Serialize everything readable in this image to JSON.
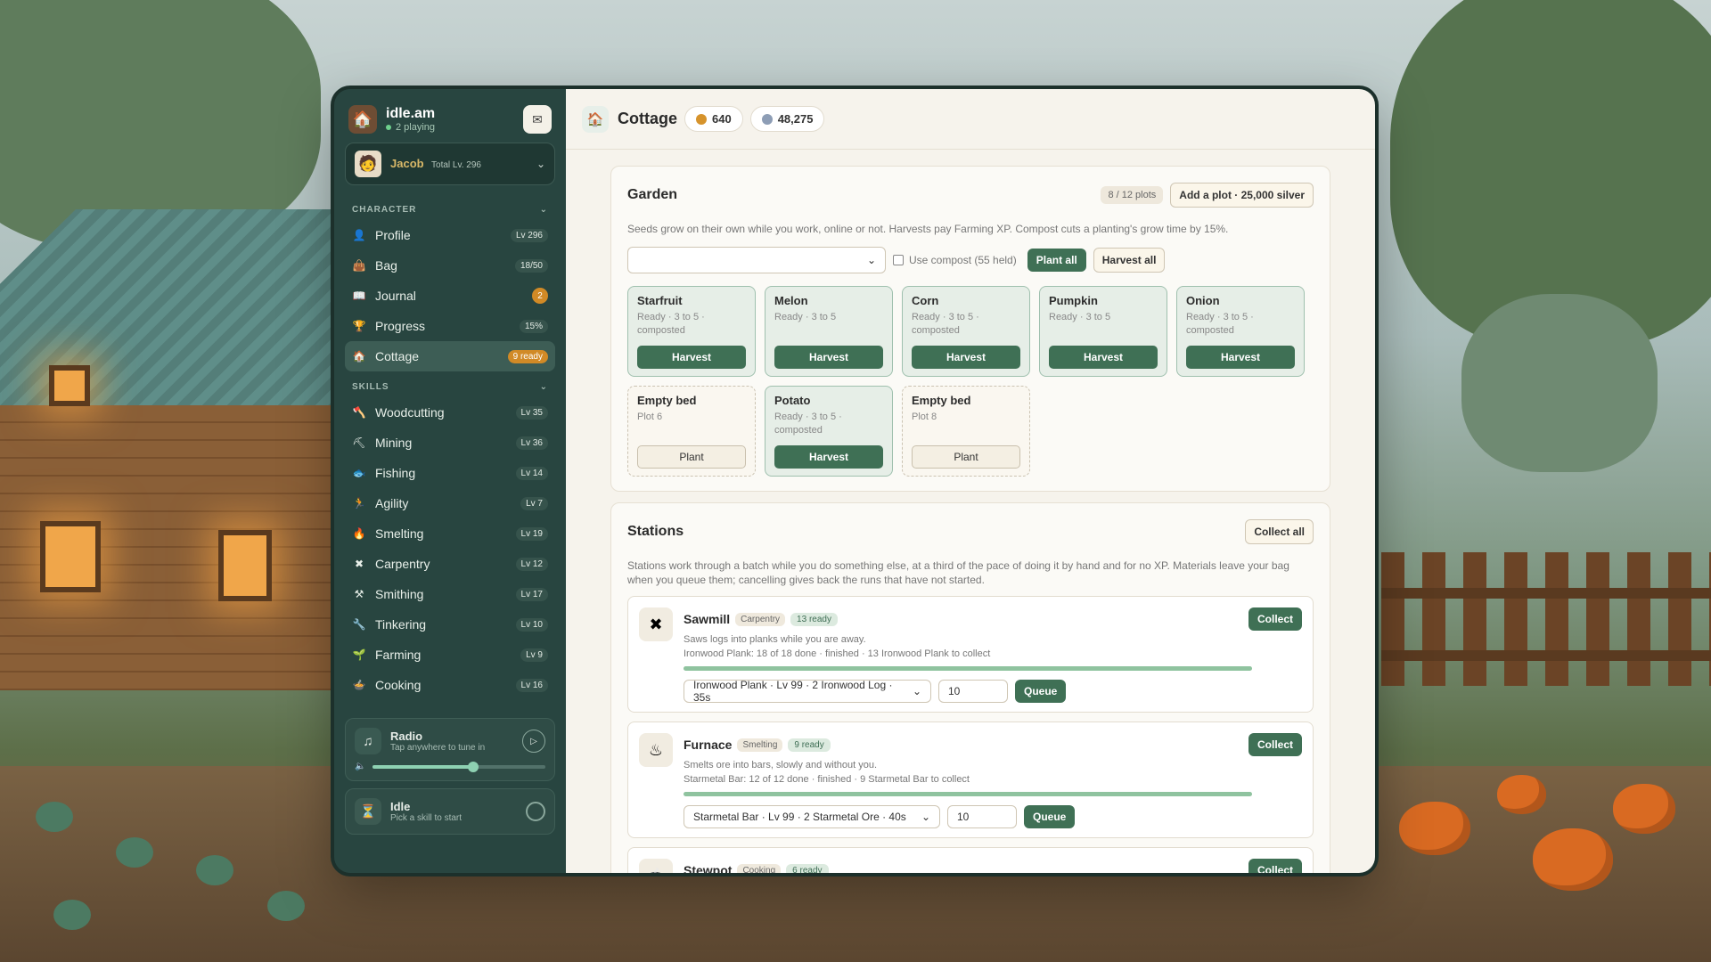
{
  "app": {
    "name": "idle.am",
    "playing": "2 playing",
    "mail_icon": "mail-icon"
  },
  "character": {
    "name": "Jacob",
    "total_level": "Total Lv. 296"
  },
  "sections": {
    "character": "CHARACTER",
    "skills": "SKILLS"
  },
  "character_nav": [
    {
      "label": "Profile",
      "badge": "Lv 296",
      "icon": "profile-icon"
    },
    {
      "label": "Bag",
      "badge": "18/50",
      "icon": "bag-icon"
    },
    {
      "label": "Journal",
      "badge": "2",
      "icon": "journal-icon"
    },
    {
      "label": "Progress",
      "badge": "15%",
      "icon": "trophy-icon"
    },
    {
      "label": "Cottage",
      "badge": "9 ready",
      "icon": "cottage-icon"
    }
  ],
  "skills_nav": [
    {
      "label": "Woodcutting",
      "badge": "Lv 35"
    },
    {
      "label": "Mining",
      "badge": "Lv 36"
    },
    {
      "label": "Fishing",
      "badge": "Lv 14"
    },
    {
      "label": "Agility",
      "badge": "Lv 7"
    },
    {
      "label": "Smelting",
      "badge": "Lv 19"
    },
    {
      "label": "Carpentry",
      "badge": "Lv 12"
    },
    {
      "label": "Smithing",
      "badge": "Lv 17"
    },
    {
      "label": "Tinkering",
      "badge": "Lv 10"
    },
    {
      "label": "Farming",
      "badge": "Lv 9"
    },
    {
      "label": "Cooking",
      "badge": "Lv 16"
    }
  ],
  "radio": {
    "title": "Radio",
    "subtitle": "Tap anywhere to tune in",
    "volume": 0.58
  },
  "idle": {
    "title": "Idle",
    "subtitle": "Pick a skill to start"
  },
  "topbar": {
    "title": "Cottage",
    "gold": "640",
    "silver": "48,275",
    "gold_color": "#d6932c",
    "silver_color": "#8d9db5"
  },
  "garden": {
    "title": "Garden",
    "plots": "8 / 12 plots",
    "add_plot": "Add a plot · 25,000 silver",
    "description": "Seeds grow on their own while you work, online or not. Harvests pay Farming XP. Compost cuts a planting's grow time by 15%.",
    "seed_select": "",
    "compost_label": "Use compost (55 held)",
    "plant_all": "Plant all",
    "harvest_all": "Harvest all",
    "beds": [
      {
        "name": "Starfruit",
        "status": "Ready · 3 to 5 · composted",
        "action": "Harvest",
        "empty": false
      },
      {
        "name": "Melon",
        "status": "Ready · 3 to 5",
        "action": "Harvest",
        "empty": false
      },
      {
        "name": "Corn",
        "status": "Ready · 3 to 5 · composted",
        "action": "Harvest",
        "empty": false
      },
      {
        "name": "Pumpkin",
        "status": "Ready · 3 to 5",
        "action": "Harvest",
        "empty": false
      },
      {
        "name": "Onion",
        "status": "Ready · 3 to 5 · composted",
        "action": "Harvest",
        "empty": false
      },
      {
        "name": "Empty bed",
        "status": "Plot 6",
        "action": "Plant",
        "empty": true
      },
      {
        "name": "Potato",
        "status": "Ready · 3 to 5 · composted",
        "action": "Harvest",
        "empty": false
      },
      {
        "name": "Empty bed",
        "status": "Plot 8",
        "action": "Plant",
        "empty": true
      }
    ]
  },
  "stations": {
    "title": "Stations",
    "collect_all": "Collect all",
    "description": "Stations work through a batch while you do something else, at a third of the pace of doing it by hand and for no XP. Materials leave your bag when you queue them; cancelling gives back the runs that have not started.",
    "items": [
      {
        "name": "Sawmill",
        "tag": "Carpentry",
        "ready": "13 ready",
        "icon": "saw-icon",
        "line1": "Saws logs into planks while you are away.",
        "line2": "Ironwood Plank: 18 of 18 done · finished · 13 Ironwood Plank to collect",
        "progress": 1.0,
        "recipe": "Ironwood Plank · Lv 99 · 2 Ironwood Log · 35s",
        "qty": "10",
        "queue": "Queue",
        "collect": "Collect"
      },
      {
        "name": "Furnace",
        "tag": "Smelting",
        "ready": "9 ready",
        "icon": "furnace-icon",
        "line1": "Smelts ore into bars, slowly and without you.",
        "line2": "Starmetal Bar: 12 of 12 done · finished · 9 Starmetal Bar to collect",
        "progress": 1.0,
        "recipe": "Starmetal Bar · Lv 99 · 2 Starmetal Ore · 40s",
        "qty": "10",
        "queue": "Queue",
        "collect": "Collect"
      },
      {
        "name": "Stewpot",
        "tag": "Cooking",
        "ready": "6 ready",
        "icon": "pot-icon",
        "line1": "",
        "line2": "",
        "progress": 1.0,
        "recipe": "",
        "qty": "",
        "queue": "",
        "collect": "Collect"
      }
    ]
  }
}
